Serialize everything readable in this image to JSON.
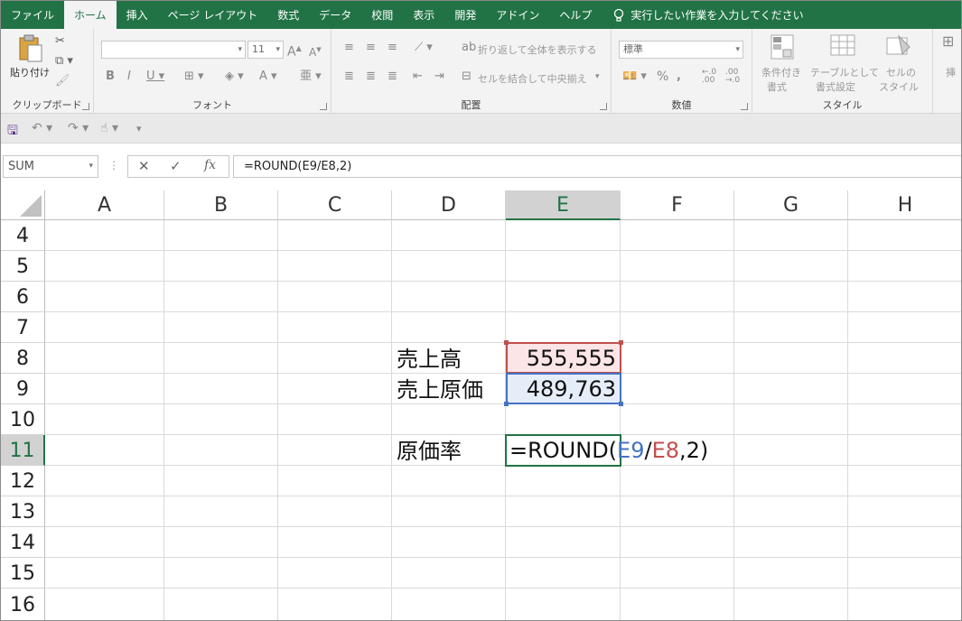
{
  "ribbon_tabs": [
    "ファイル",
    "ホーム",
    "挿入",
    "ページ レイアウト",
    "数式",
    "データ",
    "校閲",
    "表示",
    "開発",
    "アドイン",
    "ヘルプ"
  ],
  "active_tab": "ホーム",
  "tell_me": "実行したい作業を入力してください",
  "clipboard": {
    "paste": "貼り付け",
    "label": "クリップボード"
  },
  "font": {
    "size": "11",
    "label": "フォント"
  },
  "alignment": {
    "wrap": "折り返して全体を表示する",
    "merge": "セルを結合して中央揃え",
    "label": "配置"
  },
  "number": {
    "format": "標準",
    "label": "数値"
  },
  "styles": {
    "conditional_1": "条件付き",
    "conditional_2": "書式",
    "table_1": "テーブルとして",
    "table_2": "書式設定",
    "cell_1": "セルの",
    "cell_2": "スタイル",
    "label": "スタイル"
  },
  "insert_partial": "挿",
  "name_box": "SUM",
  "formula_bar": "=ROUND(E9/E8,2)",
  "columns": [
    "A",
    "B",
    "C",
    "D",
    "E",
    "F",
    "G",
    "H"
  ],
  "selected_column": "E",
  "rows": [
    "4",
    "5",
    "6",
    "7",
    "8",
    "9",
    "10",
    "11",
    "12",
    "13",
    "14",
    "15",
    "16"
  ],
  "selected_row": "11",
  "cells": {
    "d8": "売上高",
    "e8": "555,555",
    "d9": "売上原価",
    "e9": "489,763",
    "d11": "原価率",
    "e11_parts": {
      "prefix": "=ROUND(",
      "ref1": "E9",
      "slash": "/",
      "ref2": "E8",
      "suffix": ",2)"
    }
  },
  "colors": {
    "excel_green": "#217346",
    "ref_blue": "#4472c4",
    "ref_red": "#c0504d"
  }
}
